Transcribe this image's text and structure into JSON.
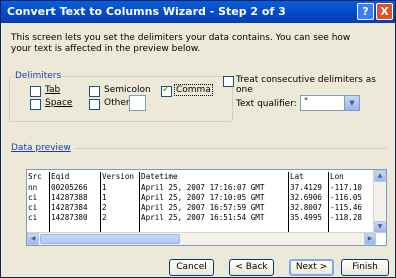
{
  "window": {
    "title": "Convert Text to Columns Wizard - Step 2 of 3",
    "help_glyph": "?",
    "close_glyph": "X"
  },
  "intro_text": "This screen lets you set the delimiters your data contains. You can see how your text is affected in the preview below.",
  "delimiters": {
    "group_label": "Delimiters",
    "items": [
      {
        "label": "Tab",
        "checked": false
      },
      {
        "label": "Semicolon",
        "checked": false
      },
      {
        "label": "Comma",
        "checked": true
      },
      {
        "label": "Space",
        "checked": false
      },
      {
        "label": "Other:",
        "checked": false
      }
    ],
    "other_value": ""
  },
  "treat_consecutive": {
    "label": "Treat consecutive delimiters as one",
    "checked": false
  },
  "text_qualifier": {
    "label": "Text qualifier:",
    "value": "\""
  },
  "preview": {
    "label": "Data preview",
    "columns": [
      "Src",
      "Eqid",
      "Version",
      "Datetime",
      "Lat",
      "Lon"
    ],
    "rows": [
      [
        "nn",
        "00205266",
        "1",
        "April 25, 2007 17:16:07 GMT",
        "37.4129",
        "-117.10"
      ],
      [
        "ci",
        "14287388",
        "1",
        "April 25, 2007 17:10:05 GMT",
        "32.6906",
        "-116.05"
      ],
      [
        "ci",
        "14287384",
        "2",
        "April 25, 2007 16:57:59 GMT",
        "32.8007",
        "-115.46"
      ],
      [
        "ci",
        "14287380",
        "2",
        "April 25, 2007 16:51:54 GMT",
        "35.4995",
        "-118.28"
      ]
    ]
  },
  "buttons": {
    "cancel": "Cancel",
    "back": "< Back",
    "next": "Next >",
    "finish": "Finish"
  },
  "colors": {
    "titlebar": "#0347c4",
    "dialog_bg": "#ece9d8",
    "accent_label": "#1a3fa8"
  }
}
